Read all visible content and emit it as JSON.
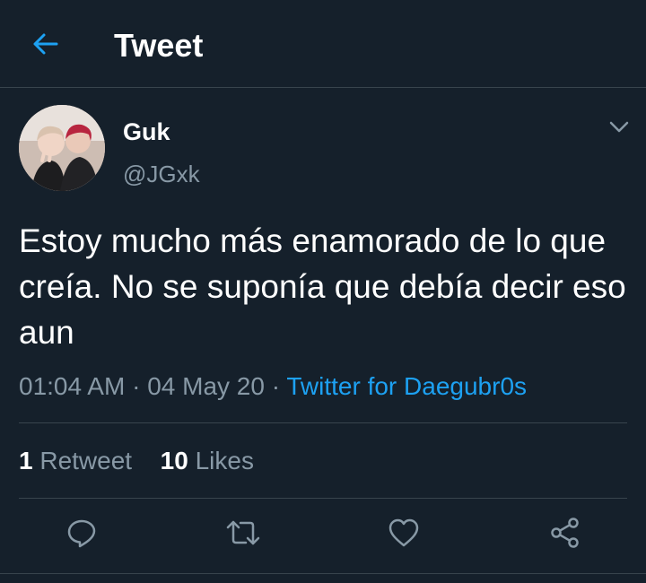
{
  "header": {
    "title": "Tweet",
    "back_icon": "back-arrow-icon"
  },
  "colors": {
    "background": "#15202b",
    "accent": "#1da1f2",
    "muted": "#8899a6",
    "divider": "#38444d"
  },
  "tweet": {
    "author_name": "Guk",
    "handle": "@JGxk",
    "text": "Estoy mucho más enamorado de lo que creía. No se suponía que debía decir eso aun",
    "time": "01:04 AM",
    "date": "04 May 20",
    "separator": " · ",
    "source": "Twitter for Daegubr0s"
  },
  "stats": {
    "retweets_count": "1",
    "retweets_label": "Retweet",
    "likes_count": "10",
    "likes_label": "Likes"
  },
  "actions": [
    "reply-icon",
    "retweet-icon",
    "like-icon",
    "share-icon"
  ]
}
